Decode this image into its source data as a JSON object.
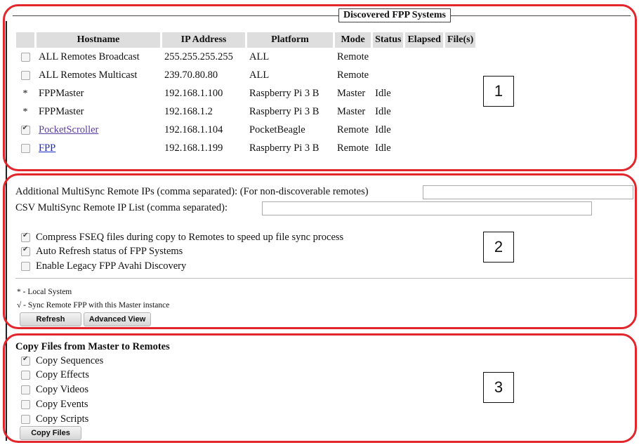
{
  "section1": {
    "legend": "Discovered FPP Systems",
    "callout_number": "1",
    "columns": [
      "",
      "Hostname",
      "IP Address",
      "Platform",
      "Mode",
      "Status",
      "Elapsed",
      "File(s)"
    ],
    "rows": [
      {
        "marker": "checkbox",
        "checked": false,
        "hostname": "ALL Remotes Broadcast",
        "ip": "255.255.255.255",
        "platform": "ALL",
        "mode": "Remote",
        "status": "",
        "link": false,
        "link_color": ""
      },
      {
        "marker": "checkbox",
        "checked": false,
        "hostname": "ALL Remotes Multicast",
        "ip": "239.70.80.80",
        "platform": "ALL",
        "mode": "Remote",
        "status": "",
        "link": false,
        "link_color": ""
      },
      {
        "marker": "*",
        "checked": false,
        "hostname": "FPPMaster",
        "ip": "192.168.1.100",
        "platform": "Raspberry Pi 3 B",
        "mode": "Master",
        "status": "Idle",
        "link": false,
        "link_color": ""
      },
      {
        "marker": "*",
        "checked": false,
        "hostname": "FPPMaster",
        "ip": "192.168.1.2",
        "platform": "Raspberry Pi 3 B",
        "mode": "Master",
        "status": "Idle",
        "link": false,
        "link_color": ""
      },
      {
        "marker": "checkbox",
        "checked": true,
        "hostname": "PocketScroller",
        "ip": "192.168.1.104",
        "platform": "PocketBeagle",
        "mode": "Remote",
        "status": "Idle",
        "link": true,
        "link_color": "#5a3d9e"
      },
      {
        "marker": "checkbox",
        "checked": false,
        "hostname": "FPP",
        "ip": "192.168.1.199",
        "platform": "Raspberry Pi 3 B",
        "mode": "Remote",
        "status": "Idle",
        "link": true,
        "link_color": "#1a27c9"
      }
    ]
  },
  "section2": {
    "callout_number": "2",
    "additional_ips_label": "Additional MultiSync Remote IPs (comma separated): (For non-discoverable remotes)",
    "additional_ips_value": "",
    "csv_label": "CSV MultiSync Remote IP List (comma separated):",
    "csv_value": "",
    "options": [
      {
        "label": "Compress FSEQ files during copy to Remotes to speed up file sync process",
        "checked": true
      },
      {
        "label": "Auto Refresh status of FPP Systems",
        "checked": true
      },
      {
        "label": "Enable Legacy FPP Avahi Discovery",
        "checked": false
      }
    ],
    "legend_local": "* - Local System",
    "legend_sync": "√ - Sync Remote FPP with this Master instance",
    "refresh_button": "Refresh",
    "advanced_button": "Advanced View"
  },
  "section3": {
    "callout_number": "3",
    "title": "Copy Files from Master to Remotes",
    "options": [
      {
        "label": "Copy Sequences",
        "checked": true
      },
      {
        "label": "Copy Effects",
        "checked": false
      },
      {
        "label": "Copy Videos",
        "checked": false
      },
      {
        "label": "Copy Events",
        "checked": false
      },
      {
        "label": "Copy Scripts",
        "checked": false
      }
    ],
    "copy_button": "Copy Files"
  },
  "colors": {
    "callout": "#e3262b",
    "header_bg": "#dedede"
  }
}
